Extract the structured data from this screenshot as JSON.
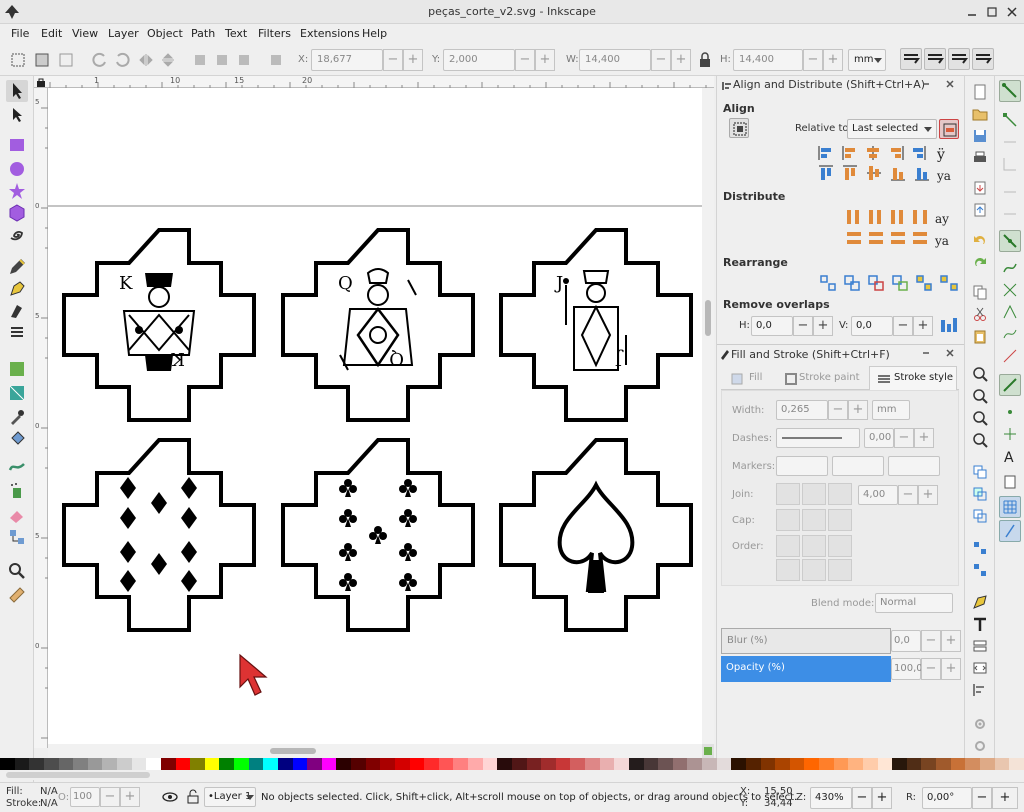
{
  "window": {
    "title": "peças_corte_v2.svg - Inkscape"
  },
  "menu": [
    "File",
    "Edit",
    "View",
    "Layer",
    "Object",
    "Path",
    "Text",
    "Filters",
    "Extensions",
    "Help"
  ],
  "toolbar": {
    "x_label": "X:",
    "x_value": "18,677",
    "y_label": "Y:",
    "y_value": "2,000",
    "w_label": "W:",
    "w_value": "14,400",
    "h_label": "H:",
    "h_value": "14,400",
    "unit": "mm",
    "minus": "−",
    "plus": "+"
  },
  "ruler": {
    "ticks": [
      "1",
      "10",
      "15",
      "20"
    ]
  },
  "ruler_left_ticks": [
    "5",
    "0",
    "5",
    "0",
    "5",
    "0",
    "5",
    "0",
    "5"
  ],
  "cards": [
    {
      "id": "king",
      "rank": "K",
      "flip": "K"
    },
    {
      "id": "queen",
      "rank": "Q",
      "flip": "Q"
    },
    {
      "id": "jack",
      "rank": "J",
      "flip": "J"
    }
  ],
  "align": {
    "dialog_title": "Align and Distribute (Shift+Ctrl+A)",
    "align_header": "Align",
    "relative_label": "Relative to:",
    "relative_value": "Last selected",
    "distribute_header": "Distribute",
    "rearrange_header": "Rearrange",
    "overlaps_header": "Remove overlaps",
    "h_label": "H:",
    "h_value": "0,0",
    "v_label": "V:",
    "v_value": "0,0"
  },
  "fillstroke": {
    "dialog_title": "Fill and Stroke (Shift+Ctrl+F)",
    "tabs": [
      "Fill",
      "Stroke paint",
      "Stroke style"
    ],
    "width_label": "Width:",
    "width_value": "0,265",
    "width_unit": "mm",
    "dashes_label": "Dashes:",
    "dashes_value": "0,00",
    "markers_label": "Markers:",
    "join_label": "Join:",
    "join_value": "4,00",
    "cap_label": "Cap:",
    "order_label": "Order:",
    "blend_label": "Blend mode:",
    "blend_value": "Normal",
    "blur_label": "Blur (%)",
    "blur_value": "0,0",
    "opacity_label": "Opacity (%)",
    "opacity_value": "100,0"
  },
  "status": {
    "fill_label": "Fill:",
    "fill_value": "N/A",
    "stroke_label": "Stroke:",
    "stroke_value": "N/A",
    "o_label": "O:",
    "o_value": "100",
    "layer": "•Layer 1",
    "message": "No objects selected. Click, Shift+click, Alt+scroll mouse on top of objects, or drag around objects to select.",
    "x_label": "X:",
    "x_value": "15,50",
    "y_label": "Y:",
    "y_value": "34,44",
    "z_label": "Z:",
    "zoom": "430%",
    "r_label": "R:",
    "rotation": "0,00°"
  },
  "colors": {
    "accent": "#3d8ee6",
    "selection_blue": "#2d7bd6"
  }
}
